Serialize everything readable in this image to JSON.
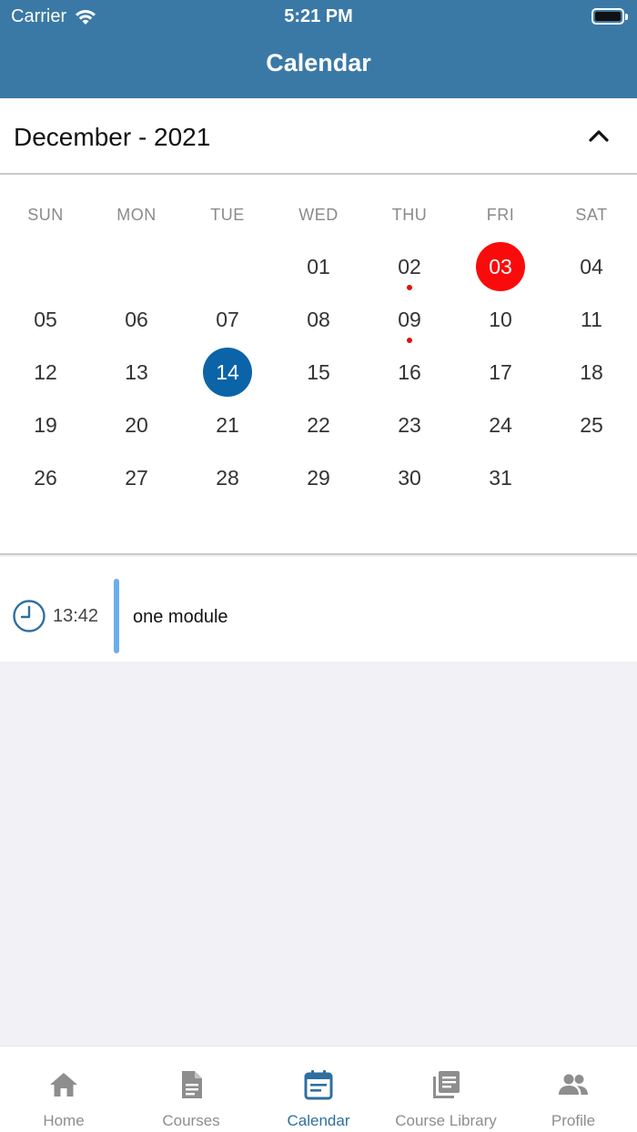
{
  "status_bar": {
    "carrier": "Carrier",
    "time": "5:21 PM"
  },
  "header": {
    "title": "Calendar"
  },
  "month_bar": {
    "label": "December - 2021",
    "toggle_icon": "chevron-up-icon"
  },
  "weekdays": [
    "SUN",
    "MON",
    "TUE",
    "WED",
    "THU",
    "FRI",
    "SAT"
  ],
  "weeks": [
    [
      "",
      "",
      "",
      "01",
      "02",
      "03",
      "04"
    ],
    [
      "05",
      "06",
      "07",
      "08",
      "09",
      "10",
      "11"
    ],
    [
      "12",
      "13",
      "14",
      "15",
      "16",
      "17",
      "18"
    ],
    [
      "19",
      "20",
      "21",
      "22",
      "23",
      "24",
      "25"
    ],
    [
      "26",
      "27",
      "28",
      "29",
      "30",
      "31",
      ""
    ]
  ],
  "today": "03",
  "selected": "14",
  "event_marked_days": [
    "02",
    "09"
  ],
  "colors": {
    "header": "#3a79a6",
    "today": "#f90b0b",
    "selected": "#0b64a8",
    "event_dot": "#e01010",
    "event_bar": "#6aaef0",
    "active_tab": "#2f6f9f"
  },
  "event": {
    "time": "13:42",
    "title": "one module",
    "icon": "clock-icon"
  },
  "tabs": [
    {
      "label": "Home",
      "icon": "home-icon",
      "active": false
    },
    {
      "label": "Courses",
      "icon": "document-icon",
      "active": false
    },
    {
      "label": "Calendar",
      "icon": "calendar-icon",
      "active": true
    },
    {
      "label": "Course Library",
      "icon": "library-icon",
      "active": false
    },
    {
      "label": "Profile",
      "icon": "people-icon",
      "active": false
    }
  ]
}
